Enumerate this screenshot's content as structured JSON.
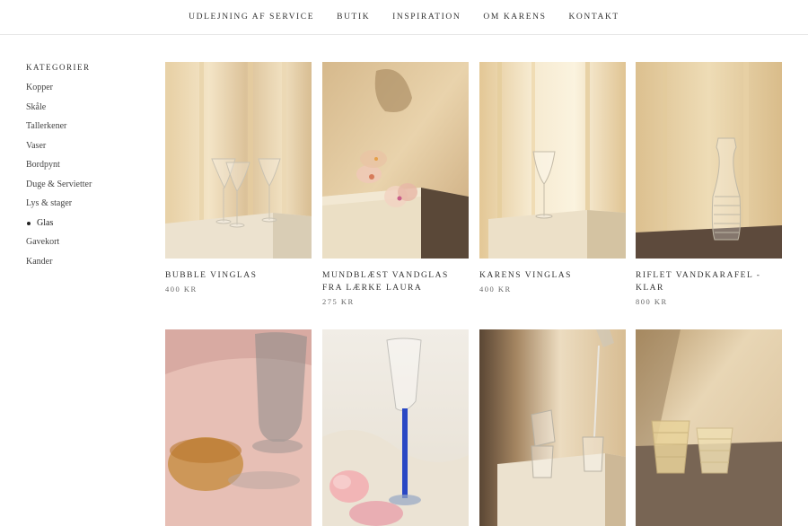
{
  "nav": {
    "items": [
      "UDLEJNING AF SERVICE",
      "BUTIK",
      "INSPIRATION",
      "OM KARENS",
      "KONTAKT"
    ]
  },
  "sidebar": {
    "heading": "KATEGORIER",
    "items": [
      {
        "label": "Kopper",
        "active": false
      },
      {
        "label": "Skåle",
        "active": false
      },
      {
        "label": "Tallerkener",
        "active": false
      },
      {
        "label": "Vaser",
        "active": false
      },
      {
        "label": "Bordpynt",
        "active": false
      },
      {
        "label": "Duge & Servietter",
        "active": false
      },
      {
        "label": "Lys & stager",
        "active": false
      },
      {
        "label": "Glas",
        "active": true
      },
      {
        "label": "Gavekort",
        "active": false
      },
      {
        "label": "Kander",
        "active": false
      }
    ]
  },
  "products": [
    {
      "title": "BUBBLE VINGLAS",
      "price": "400 KR",
      "image": "bubble-wine-glasses"
    },
    {
      "title": "MUNDBLÆST VANDGLAS FRA LÆRKE LAURA",
      "price": "275 KR",
      "image": "mouth-blown-water-glasses"
    },
    {
      "title": "KARENS VINGLAS",
      "price": "400 KR",
      "image": "karens-wine-glass"
    },
    {
      "title": "RIFLET VANDKARAFEL - KLAR",
      "price": "800 KR",
      "image": "ribbed-carafe"
    },
    {
      "title": "",
      "price": "",
      "image": "amber-glass-on-pink-cloth"
    },
    {
      "title": "",
      "price": "",
      "image": "blue-stem-glass-with-flower"
    },
    {
      "title": "",
      "price": "",
      "image": "water-pouring-into-glasses"
    },
    {
      "title": "",
      "price": "",
      "image": "yellow-ribbed-glasses"
    }
  ]
}
